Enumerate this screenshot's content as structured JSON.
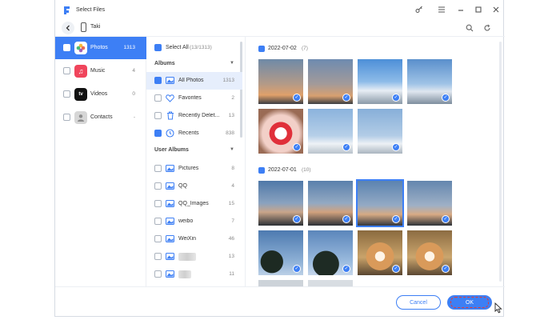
{
  "window": {
    "title": "Select Files"
  },
  "titlebar": {
    "icons": [
      "key-icon",
      "menu-icon",
      "minimize-icon",
      "maximize-icon",
      "close-icon"
    ]
  },
  "device": {
    "name": "Taki"
  },
  "categories": [
    {
      "label": "Photos",
      "count": "1313",
      "icon": "photos-icon",
      "color": "#f06a3a",
      "active": true
    },
    {
      "label": "Music",
      "count": "4",
      "icon": "music-icon",
      "color": "#f0455c",
      "active": false
    },
    {
      "label": "Videos",
      "count": "0",
      "icon": "appletv-icon",
      "color": "#111111",
      "active": false
    },
    {
      "label": "Contacts",
      "count": "-",
      "icon": "contacts-icon",
      "color": "#c9c9c9",
      "active": false
    }
  ],
  "albums_panel": {
    "select_all_label": "Select All",
    "select_all_count": "(13/1313)",
    "albums_header": "Albums",
    "user_albums_header": "User Albums",
    "albums": [
      {
        "label": "All Photos",
        "count": "1313",
        "icon": "album-icon",
        "checked": true,
        "active": true
      },
      {
        "label": "Favorites",
        "count": "2",
        "icon": "heart-icon",
        "checked": false,
        "active": false
      },
      {
        "label": "Recently Delet...",
        "count": "13",
        "icon": "trash-icon",
        "checked": false,
        "active": false
      },
      {
        "label": "Recents",
        "count": "838",
        "icon": "clock-icon",
        "checked": true,
        "active": false
      }
    ],
    "user_albums": [
      {
        "label": "Pictures",
        "count": "8",
        "blurred": false
      },
      {
        "label": "QQ",
        "count": "4",
        "blurred": false
      },
      {
        "label": "QQ_Images",
        "count": "15",
        "blurred": false
      },
      {
        "label": "weibo",
        "count": "7",
        "blurred": false
      },
      {
        "label": "WeiXin",
        "count": "46",
        "blurred": false
      },
      {
        "label": "",
        "count": "13",
        "blurred": true
      },
      {
        "label": "",
        "count": "11",
        "blurred": true
      }
    ]
  },
  "photo_groups": [
    {
      "date": "2022-07-02",
      "count": "(7)",
      "photos": [
        "sunset-sky",
        "sunset-sky",
        "blue-sky-clouds",
        "blue-sky-clouds",
        "food-closeup",
        "light-blue-sky",
        "light-blue-sky"
      ]
    },
    {
      "date": "2022-07-01",
      "count": "(10)",
      "photos": [
        "city-dusk",
        "city-dusk",
        "city-dusk-selected",
        "city-dusk",
        "trees-sky",
        "trees-sky",
        "shiba-dog",
        "shiba-dog"
      ]
    }
  ],
  "footer": {
    "cancel_label": "Cancel",
    "ok_label": "OK"
  },
  "colors": {
    "accent": "#3d7ff5",
    "highlight": "#e53935"
  }
}
